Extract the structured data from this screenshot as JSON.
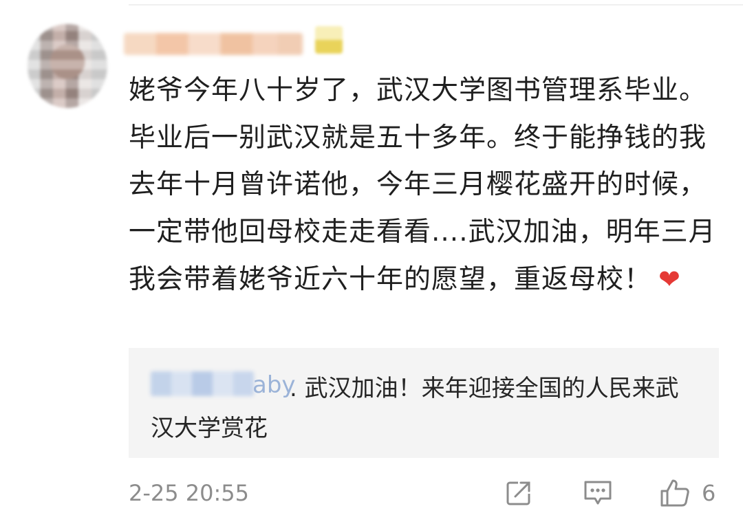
{
  "comment": {
    "text": "姥爷今年八十岁了，武汉大学图书管理系毕业。毕业后一别武汉就是五十多年。终于能挣钱的我去年十月曾许诺他，今年三月樱花盛开的时候，一定带他回母校走走看看....武汉加油，明年三月我会带着姥爷近六十年的愿望，重返母校！",
    "heart": "❤"
  },
  "reply": {
    "user_tail": "aby",
    "text": ". 武汉加油！来年迎接全国的人民来武汉大学赏花"
  },
  "footer": {
    "timestamp": "2-25 20:55",
    "like_count": "6"
  },
  "icons": {
    "share": "share-external-icon",
    "comment": "comment-bubble-icon",
    "like": "thumbs-up-icon"
  },
  "colors": {
    "text": "#1f1f1f",
    "muted": "#8c8c8c",
    "reply_bg": "#f4f4f4",
    "heart": "#e53935"
  }
}
